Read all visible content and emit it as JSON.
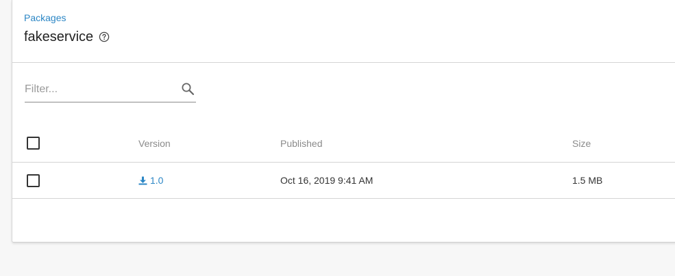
{
  "header": {
    "breadcrumb": "Packages",
    "title": "fakeservice",
    "help_icon": "help-circle-icon"
  },
  "filter": {
    "placeholder": "Filter...",
    "value": "",
    "icon": "search-icon"
  },
  "table": {
    "columns": [
      "Version",
      "Published",
      "Size"
    ],
    "rows": [
      {
        "version": "1.0",
        "published": "Oct 16, 2019 9:41 AM",
        "size": "1.5 MB",
        "checked": false
      }
    ],
    "select_all_checked": false
  },
  "colors": {
    "accent": "#2b86c5",
    "background": "#f7f7f7",
    "card": "#ffffff"
  }
}
